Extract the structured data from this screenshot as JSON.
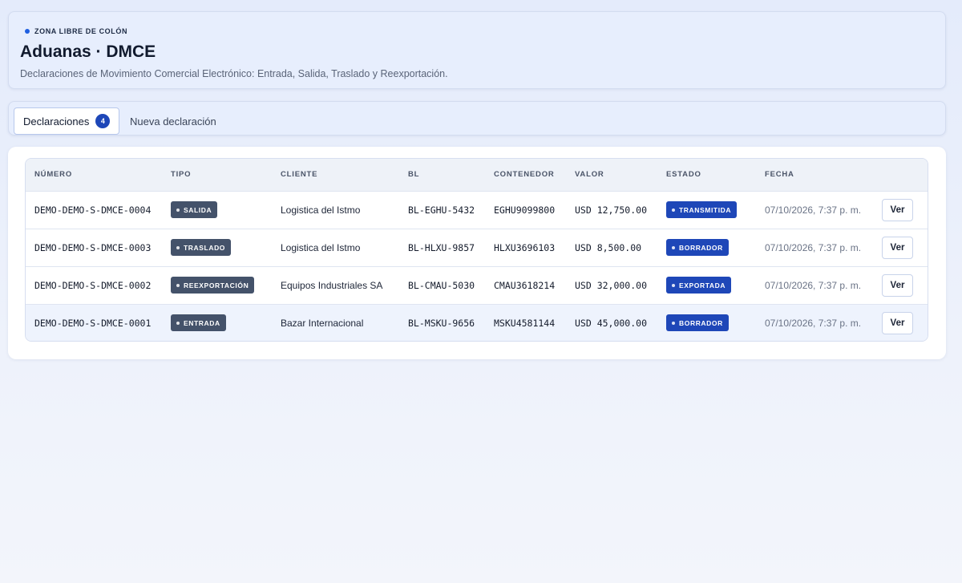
{
  "header": {
    "eyebrow": "ZONA LIBRE DE COLÓN",
    "title": "Aduanas · DMCE",
    "subtitle": "Declaraciones de Movimiento Comercial Electrónico: Entrada, Salida, Traslado y Reexportación."
  },
  "tabs": {
    "declaraciones_label": "Declaraciones",
    "declaraciones_count": "4",
    "nueva_label": "Nueva declaración"
  },
  "table": {
    "columns": [
      "NÚMERO",
      "TIPO",
      "CLIENTE",
      "BL",
      "CONTENEDOR",
      "VALOR",
      "ESTADO",
      "FECHA",
      ""
    ],
    "rows": [
      {
        "numero": "DEMO-DEMO-S-DMCE-0004",
        "tipo": "SALIDA",
        "cliente": "Logistica del Istmo",
        "bl": "BL-EGHU-5432",
        "contenedor": "EGHU9099800",
        "valor": "USD 12,750.00",
        "estado": "TRANSMITIDA",
        "fecha": "07/10/2026, 7:37 p. m.",
        "action": "Ver"
      },
      {
        "numero": "DEMO-DEMO-S-DMCE-0003",
        "tipo": "TRASLADO",
        "cliente": "Logistica del Istmo",
        "bl": "BL-HLXU-9857",
        "contenedor": "HLXU3696103",
        "valor": "USD 8,500.00",
        "estado": "BORRADOR",
        "fecha": "07/10/2026, 7:37 p. m.",
        "action": "Ver"
      },
      {
        "numero": "DEMO-DEMO-S-DMCE-0002",
        "tipo": "REEXPORTACIÓN",
        "cliente": "Equipos Industriales SA",
        "bl": "BL-CMAU-5030",
        "contenedor": "CMAU3618214",
        "valor": "USD 32,000.00",
        "estado": "EXPORTADA",
        "fecha": "07/10/2026, 7:37 p. m.",
        "action": "Ver"
      },
      {
        "numero": "DEMO-DEMO-S-DMCE-0001",
        "tipo": "ENTRADA",
        "cliente": "Bazar Internacional",
        "bl": "BL-MSKU-9656",
        "contenedor": "MSKU4581144",
        "valor": "USD 45,000.00",
        "estado": "BORRADOR",
        "fecha": "07/10/2026, 7:37 p. m.",
        "action": "Ver"
      }
    ]
  },
  "colors": {
    "accent": "#1e47b8",
    "type_pill": "#44526a",
    "dot": "#1f5fe0"
  }
}
